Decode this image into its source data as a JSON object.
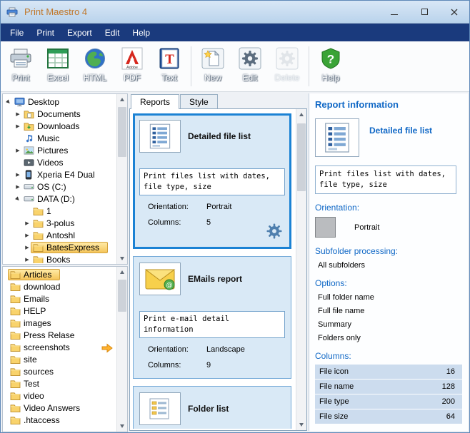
{
  "colors": {
    "accent": "#1b82d4",
    "heading_blue": "#1068c6",
    "menubar_blue": "#1a3a7d",
    "selection_yellow": "#f5c55a",
    "card_bg": "#d9e9f6"
  },
  "window": {
    "title": "Print Maestro 4"
  },
  "menu": {
    "items": [
      "File",
      "Print",
      "Export",
      "Edit",
      "Help"
    ]
  },
  "toolbar": {
    "groups": [
      [
        {
          "label": "Print",
          "icon": "printer-icon",
          "enabled": true
        },
        {
          "label": "Excel",
          "icon": "excel-icon",
          "enabled": true
        },
        {
          "label": "HTML",
          "icon": "globe-icon",
          "enabled": true
        },
        {
          "label": "PDF",
          "icon": "adobe-pdf-icon",
          "icon_text": "Adobe",
          "enabled": true
        },
        {
          "label": "Text",
          "icon": "text-book-icon",
          "icon_text": "T",
          "enabled": true
        }
      ],
      [
        {
          "label": "New",
          "icon": "new-document-icon",
          "enabled": true
        },
        {
          "label": "Edit",
          "icon": "edit-gear-icon",
          "enabled": true
        },
        {
          "label": "Delete",
          "icon": "delete-gear-icon",
          "enabled": false
        }
      ],
      [
        {
          "label": "Help",
          "icon": "help-icon",
          "icon_text": "?",
          "enabled": true
        }
      ]
    ]
  },
  "tree": {
    "items": [
      {
        "label": "Desktop",
        "icon": "desktop",
        "arrow": "expanded",
        "indent": 0
      },
      {
        "label": "Documents",
        "icon": "documents",
        "arrow": "collapsed",
        "indent": 1
      },
      {
        "label": "Downloads",
        "icon": "downloads",
        "arrow": "collapsed",
        "indent": 1
      },
      {
        "label": "Music",
        "icon": "music",
        "arrow": "none",
        "indent": 1
      },
      {
        "label": "Pictures",
        "icon": "pictures",
        "arrow": "collapsed",
        "indent": 1
      },
      {
        "label": "Videos",
        "icon": "videos",
        "arrow": "none",
        "indent": 1
      },
      {
        "label": "Xperia E4 Dual",
        "icon": "phone",
        "arrow": "collapsed",
        "indent": 1
      },
      {
        "label": "OS (C:)",
        "icon": "drive",
        "arrow": "collapsed",
        "indent": 1
      },
      {
        "label": "DATA (D:)",
        "icon": "drive",
        "arrow": "expanded",
        "indent": 1
      },
      {
        "label": "1",
        "icon": "folder",
        "arrow": "none",
        "indent": 2
      },
      {
        "label": "3-polus",
        "icon": "folder",
        "arrow": "collapsed",
        "indent": 2
      },
      {
        "label": "Antoshl",
        "icon": "folder",
        "arrow": "collapsed",
        "indent": 2
      },
      {
        "label": "BatesExpress",
        "icon": "folder",
        "arrow": "collapsed",
        "indent": 2,
        "selected": true
      },
      {
        "label": "Books",
        "icon": "folder",
        "arrow": "collapsed",
        "indent": 2
      }
    ]
  },
  "folder_list": {
    "items": [
      {
        "label": "Articles",
        "selected": true
      },
      {
        "label": "download"
      },
      {
        "label": "Emails"
      },
      {
        "label": "HELP"
      },
      {
        "label": "images"
      },
      {
        "label": "Press Relase"
      },
      {
        "label": "screenshots"
      },
      {
        "label": "site"
      },
      {
        "label": "sources"
      },
      {
        "label": "Test"
      },
      {
        "label": "video"
      },
      {
        "label": "Video Answers"
      },
      {
        "label": ".htaccess"
      }
    ]
  },
  "reports_panel": {
    "tabs": [
      {
        "label": "Reports",
        "active": true
      },
      {
        "label": "Style",
        "active": false
      }
    ],
    "cards": [
      {
        "title": "Detailed file list",
        "icon": "file-list",
        "description": "Print files list with dates, file type, size",
        "orientation_label": "Orientation:",
        "orientation": "Portrait",
        "columns_label": "Columns:",
        "columns": "5",
        "selected": true
      },
      {
        "title": "EMails report",
        "icon": "email",
        "description": "Print e-mail detail information",
        "orientation_label": "Orientation:",
        "orientation": "Landscape",
        "columns_label": "Columns:",
        "columns": "9",
        "selected": false
      },
      {
        "title": "Folder list",
        "icon": "folder-list",
        "selected": false
      }
    ]
  },
  "report_info": {
    "header": "Report information",
    "report_name": "Detailed file list",
    "description": "Print files list with dates, file type, size",
    "orientation_label": "Orientation:",
    "orientation": "Portrait",
    "subfolder_label": "Subfolder processing:",
    "subfolder_value": "All subfolders",
    "options_label": "Options:",
    "options": [
      "Full folder name",
      "Full file name",
      "Summary",
      "Folders only"
    ],
    "columns_label": "Columns:",
    "columns": [
      {
        "name": "File icon",
        "width": "16"
      },
      {
        "name": "File name",
        "width": "128"
      },
      {
        "name": "File type",
        "width": "200"
      },
      {
        "name": "File size",
        "width": "64"
      }
    ]
  }
}
